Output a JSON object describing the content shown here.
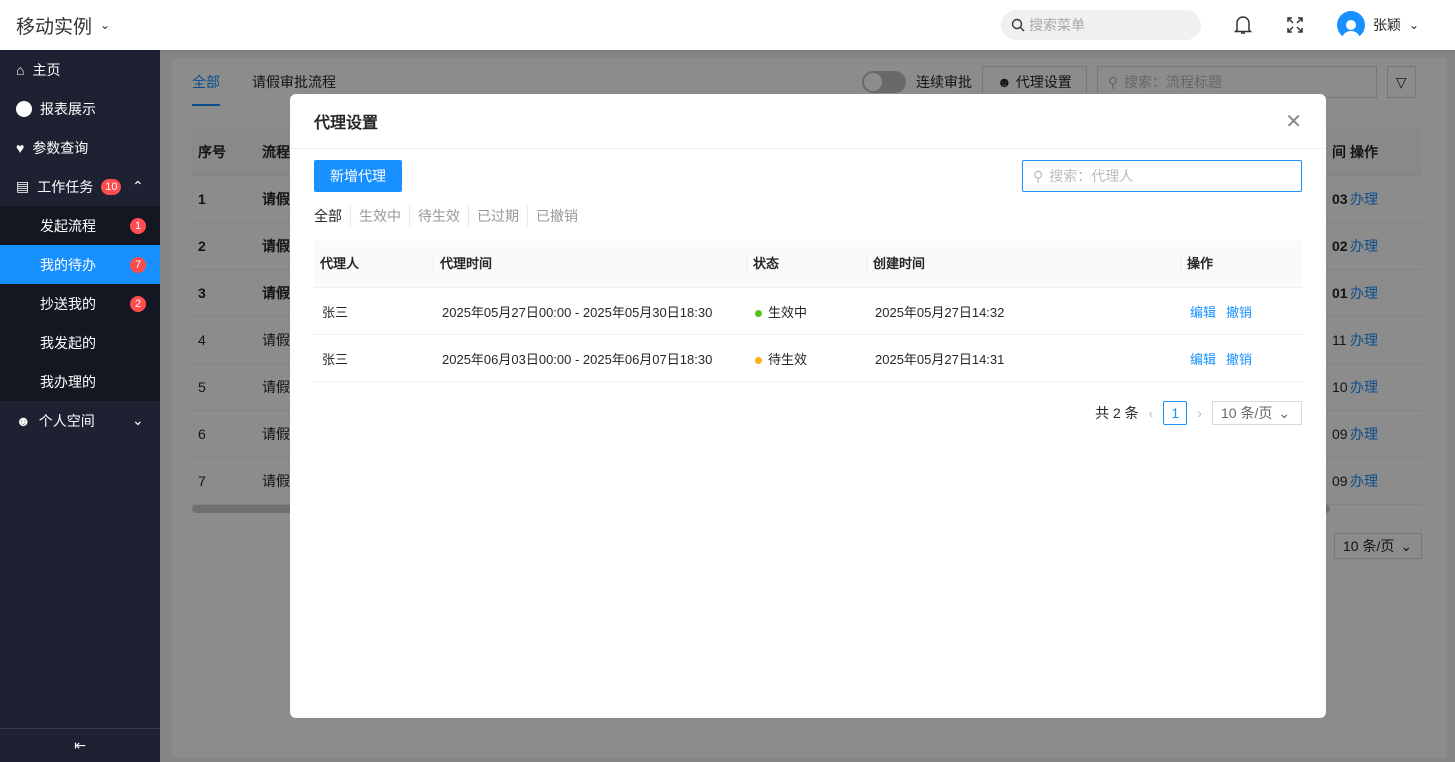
{
  "header": {
    "app_title": "移动实例",
    "search_placeholder": "搜索菜单",
    "user_name": "张颖"
  },
  "sidebar": {
    "items": [
      {
        "label": "主页"
      },
      {
        "label": "报表展示"
      },
      {
        "label": "参数查询"
      },
      {
        "label": "工作任务",
        "badge": "10"
      }
    ],
    "sub_items": [
      {
        "label": "发起流程",
        "badge": "1"
      },
      {
        "label": "我的待办",
        "badge": "7"
      },
      {
        "label": "抄送我的",
        "badge": "2"
      },
      {
        "label": "我发起的"
      },
      {
        "label": "我办理的"
      }
    ],
    "personal": {
      "label": "个人空间"
    }
  },
  "main": {
    "tabs": [
      "全部",
      "请假审批流程"
    ],
    "toggle_label": "连续审批",
    "agent_button": "代理设置",
    "search_placeholder": "搜索：流程标题",
    "table_headers": {
      "no": "序号",
      "flow": "流程",
      "time": "间",
      "action": "操作"
    },
    "rows": [
      {
        "no": "1",
        "flow": "请假",
        "time": "03",
        "action": "办理"
      },
      {
        "no": "2",
        "flow": "请假",
        "time": "02",
        "action": "办理"
      },
      {
        "no": "3",
        "flow": "请假",
        "time": "01",
        "action": "办理"
      },
      {
        "no": "4",
        "flow": "请假",
        "time": "11",
        "action": "办理"
      },
      {
        "no": "5",
        "flow": "请假",
        "time": "10",
        "action": "办理"
      },
      {
        "no": "6",
        "flow": "请假",
        "time": "09",
        "action": "办理"
      },
      {
        "no": "7",
        "flow": "请假",
        "time": "09",
        "action": "办理"
      }
    ],
    "page_size": "10 条/页"
  },
  "modal": {
    "title": "代理设置",
    "add_button": "新增代理",
    "search_placeholder": "搜索：代理人",
    "filters": [
      "全部",
      "生效中",
      "待生效",
      "已过期",
      "已撤销"
    ],
    "headers": {
      "agent": "代理人",
      "period": "代理时间",
      "status": "状态",
      "created": "创建时间",
      "action": "操作"
    },
    "rows": [
      {
        "agent": "张三",
        "period": "2025年05月27日00:00 - 2025年05月30日18:30",
        "status": "生效中",
        "status_color": "#52c41a",
        "created": "2025年05月27日14:32",
        "edit": "编辑",
        "revoke": "撤销"
      },
      {
        "agent": "张三",
        "period": "2025年06月03日00:00 - 2025年06月07日18:30",
        "status": "待生效",
        "status_color": "#faad14",
        "created": "2025年05月27日14:31",
        "edit": "编辑",
        "revoke": "撤销"
      }
    ],
    "pager": {
      "total": "共 2 条",
      "current": "1",
      "page_size": "10 条/页"
    }
  }
}
